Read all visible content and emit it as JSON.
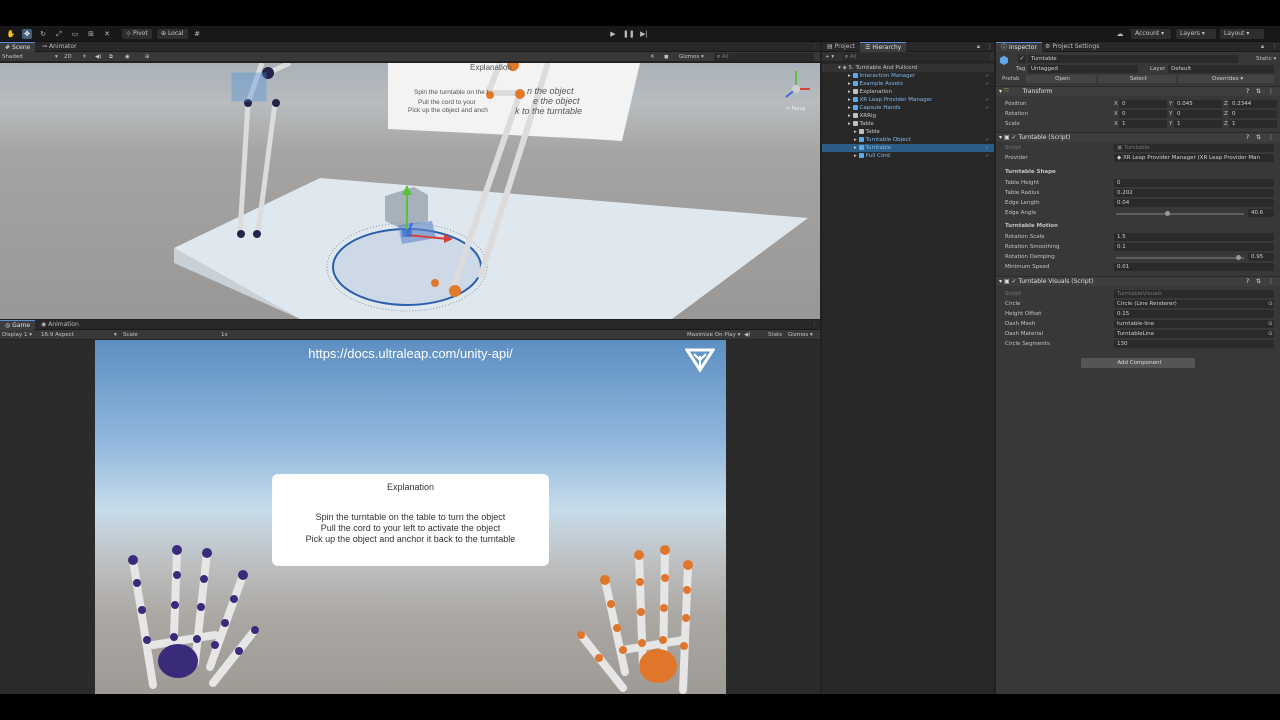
{
  "toolbar": {
    "tools": [
      "hand-tool",
      "move-tool",
      "rotate-tool",
      "scale-tool",
      "rect-tool",
      "transform-tool",
      "custom-tool"
    ],
    "pivot_label": "Pivot",
    "local_label": "Local",
    "account_label": "Account",
    "layers_label": "Layers",
    "layout_label": "Layout"
  },
  "scene_panel": {
    "tabs": [
      "Scene",
      "Animator"
    ],
    "shading_mode": "Shaded",
    "mode_2d": "2D",
    "gizmos_label": "Gizmos",
    "search_placeholder": "All",
    "card_title": "Explanation",
    "card_lines": [
      "Spin the turntable on the table to turn the object",
      "Pull the cord to your left to activate the object",
      "Pick up the object and anchor it back to the turntable"
    ],
    "visible_line_fragments": [
      "Spin the turntable on the t",
      "n the object",
      "Pull the cord to your",
      "e the object",
      "Pick up the object and anch",
      "k to the turntable"
    ],
    "persp_label": "< Persp"
  },
  "game_panel": {
    "tabs": [
      "Game",
      "Animation"
    ],
    "display": "Display 1",
    "aspect": "16:9 Aspect",
    "scale_label": "Scale",
    "scale_value": "1x",
    "maximize_label": "Maximize On Play",
    "stats_label": "Stats",
    "gizmos_label": "Gizmos",
    "url": "https://docs.ultraleap.com/unity-api/",
    "explain_title": "Explanation",
    "explain_lines": [
      "Spin the turntable on the table to turn the object",
      "Pull the cord to your left to activate the object",
      "Pick up the object and anchor it back to the turntable"
    ]
  },
  "hierarchy": {
    "tabs": [
      "Project",
      "Hierarchy"
    ],
    "search_placeholder": "All",
    "scene_name": "5. Turntable And Pullcord",
    "items": [
      {
        "label": "Interaction Manager",
        "indent": 1,
        "prefab": true
      },
      {
        "label": "Example Assets",
        "indent": 1,
        "prefab": true
      },
      {
        "label": "Explanation",
        "indent": 1,
        "prefab": false
      },
      {
        "label": "XR Leap Provider Manager",
        "indent": 1,
        "prefab": true
      },
      {
        "label": "Capsule Hands",
        "indent": 1,
        "prefab": true
      },
      {
        "label": "XRRig",
        "indent": 1,
        "prefab": false
      },
      {
        "label": "Table",
        "indent": 1,
        "prefab": false
      },
      {
        "label": "Table",
        "indent": 2,
        "prefab": false
      },
      {
        "label": "Turntable Object",
        "indent": 2,
        "prefab": true
      },
      {
        "label": "Turntable",
        "indent": 2,
        "prefab": true,
        "selected": true
      },
      {
        "label": "Pull Cord",
        "indent": 2,
        "prefab": true
      }
    ]
  },
  "inspector": {
    "tabs": [
      "Inspector",
      "Project Settings"
    ],
    "object_name": "Turntable",
    "static_label": "Static",
    "tag_label": "Tag",
    "tag_value": "Untagged",
    "layer_label": "Layer",
    "layer_value": "Default",
    "prefab_label": "Prefab",
    "open_label": "Open",
    "select_label": "Select",
    "overrides_label": "Overrides",
    "transform": {
      "title": "Transform",
      "rows": [
        {
          "label": "Position",
          "x": "0",
          "y": "0.045",
          "z": "0.2344"
        },
        {
          "label": "Rotation",
          "x": "0",
          "y": "0",
          "z": "0"
        },
        {
          "label": "Scale",
          "x": "1",
          "y": "1",
          "z": "1"
        }
      ]
    },
    "turntable_script": {
      "title": "Turntable (Script)",
      "script_label": "Script",
      "script_value": "Turntable",
      "provider_label": "Provider",
      "provider_value": "XR Leap Provider Manager (XR Leap Provider Man",
      "shape_header": "Turntable Shape",
      "shape": [
        {
          "label": "Table Height",
          "value": "0"
        },
        {
          "label": "Table Radius",
          "value": "0.202"
        },
        {
          "label": "Edge Length",
          "value": "0.04"
        },
        {
          "label": "Edge Angle",
          "value": "40.6",
          "slider": 0.4
        }
      ],
      "motion_header": "Turntable Motion",
      "motion": [
        {
          "label": "Rotation Scale",
          "value": "1.5"
        },
        {
          "label": "Rotation Smoothing",
          "value": "0.1"
        },
        {
          "label": "Rotation Damping",
          "value": "0.95",
          "slider": 0.95
        },
        {
          "label": "Minimum Speed",
          "value": "0.01"
        }
      ]
    },
    "visuals_script": {
      "title": "Turntable Visuals (Script)",
      "rows": [
        {
          "label": "Script",
          "value": "TurntableVisuals"
        },
        {
          "label": "Circle",
          "value": "Circle (Line Renderer)"
        },
        {
          "label": "Height Offset",
          "value": "0.15"
        },
        {
          "label": "Dash Mesh",
          "value": "turntable-line"
        },
        {
          "label": "Dash Material",
          "value": "TurntableLine"
        },
        {
          "label": "Circle Segments",
          "value": "130"
        }
      ]
    },
    "add_component_label": "Add Component"
  },
  "colors": {
    "accent_blue": "#5a8fd6",
    "selection": "#2c5d87",
    "prefab_blue": "#62a8e8",
    "hand_left": "#3a2a7a",
    "hand_right": "#e0762a"
  }
}
